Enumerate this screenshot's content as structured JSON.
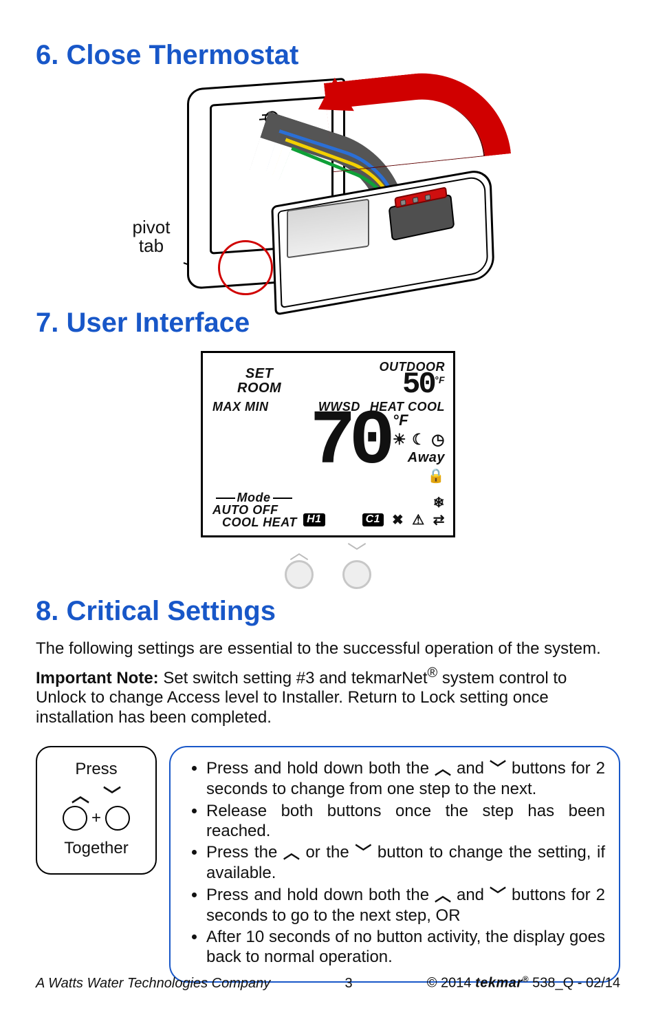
{
  "sections": {
    "s6": {
      "title": "6. Close Thermostat",
      "pivot_label_line1": "pivot",
      "pivot_label_line2": "tab"
    },
    "s7": {
      "title": "7. User Interface",
      "lcd": {
        "set": "SET",
        "room": "ROOM",
        "maxmin": "MAX MIN",
        "outdoor": "OUTDOOR",
        "outdoor_temp": "50",
        "outdoor_unit": "°F",
        "wwsd": "WWSD",
        "heat": "HEAT",
        "cool": "COOL",
        "main_temp": "70",
        "main_unit": "°F",
        "away": "Away",
        "mode_label": "Mode",
        "auto": "AUTO",
        "off": "OFF",
        "cool2": "COOL",
        "heat2": "HEAT",
        "h1": "H1",
        "c1": "C1"
      }
    },
    "s8": {
      "title": "8. Critical Settings",
      "intro": "The following settings are essential to the successful operation of the system.",
      "note_label": "Important Note:",
      "note_body_a": " Set switch setting #3 and tekmarNet",
      "note_sup": "®",
      "note_body_b": " system control to Unlock to change Access level to Installer. Return to Lock setting once installation has been completed.",
      "press_top": "Press",
      "press_plus": "+",
      "press_bottom": "Together",
      "steps": {
        "s1a": "Press and hold down both the ",
        "s1b": " and ",
        "s1c": " buttons for 2 seconds to change from one step to the next.",
        "s2": "Release both buttons once the step has been reached.",
        "s3a": "Press the ",
        "s3b": " or the ",
        "s3c": " button to change the setting, if available.",
        "s4a": "Press and hold down both the ",
        "s4b": " and ",
        "s4c": " buttons for 2 seconds to go to the next step, OR",
        "s5": "After 10 seconds of no button activity, the display goes back to normal operation."
      }
    }
  },
  "footer": {
    "left": "A Watts Water Technologies Company",
    "page": "3",
    "copyright": "© 2014",
    "brand": "tekmar",
    "reg": "®",
    "doc": " 538_Q - 02/14"
  }
}
